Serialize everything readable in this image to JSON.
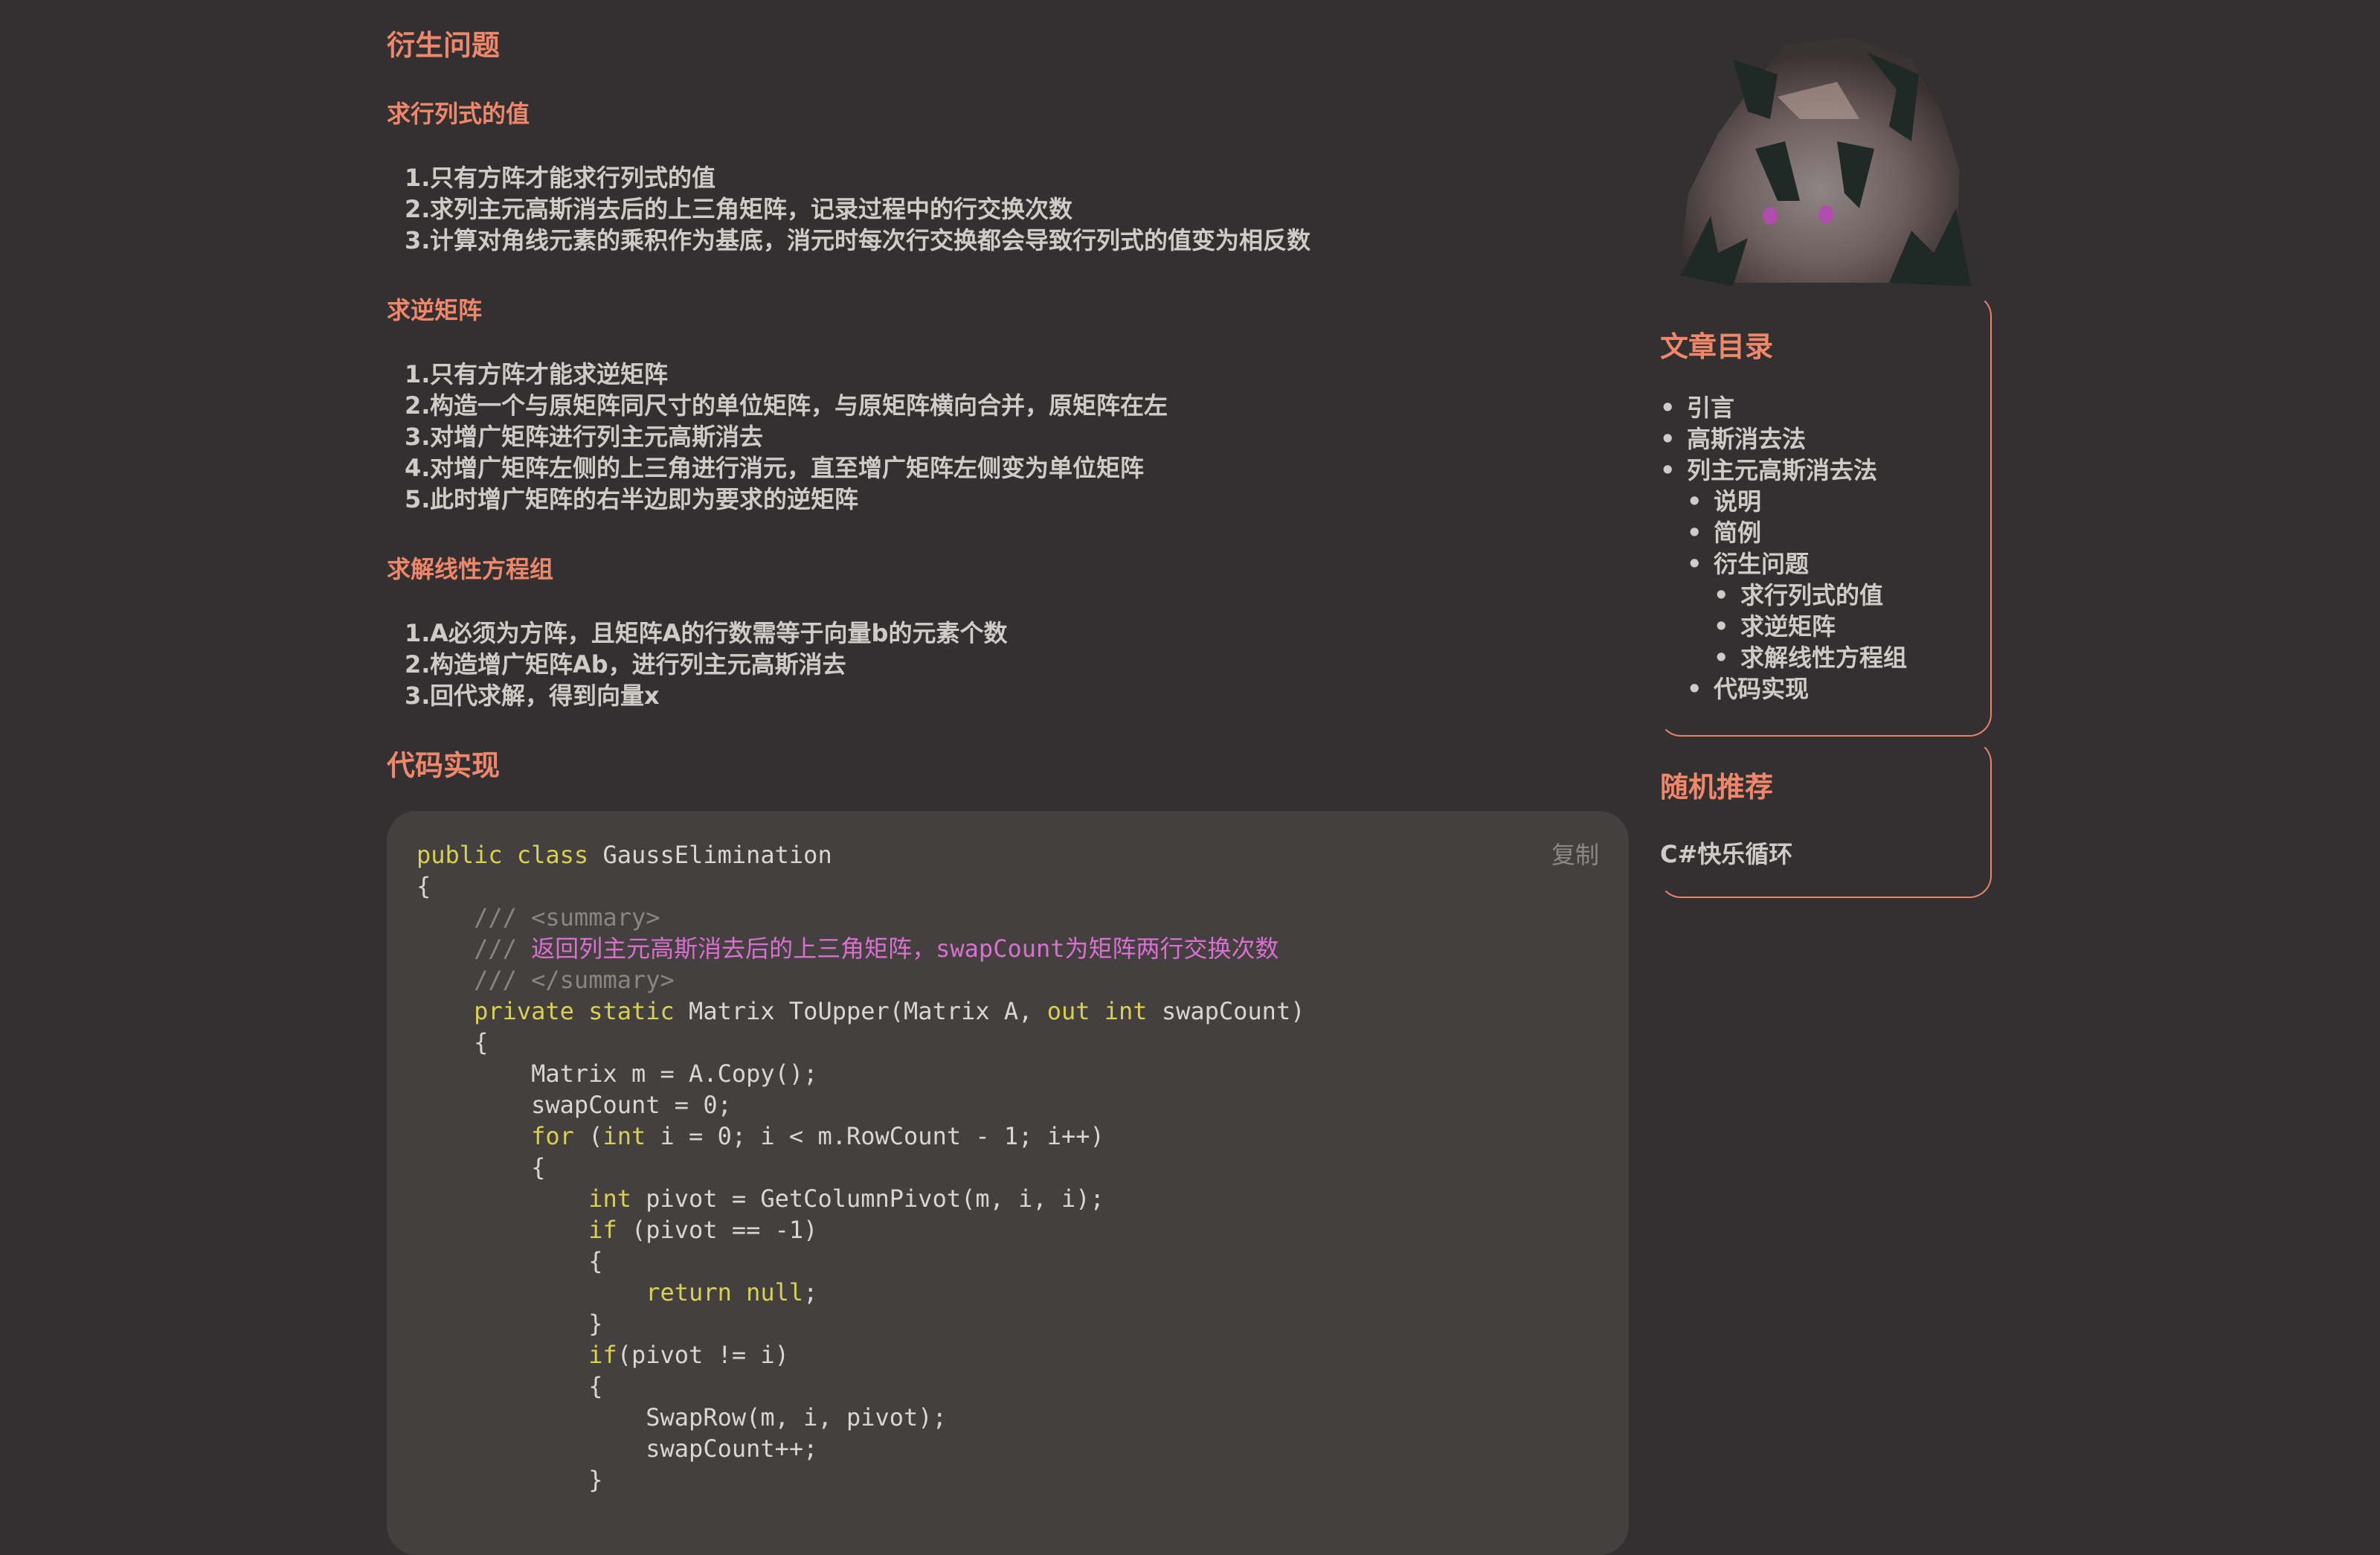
{
  "article": {
    "section_derived": "衍生问题",
    "determinant": {
      "title": "求行列式的值",
      "steps": [
        "只有方阵才能求行列式的值",
        "求列主元高斯消去后的上三角矩阵，记录过程中的行交换次数",
        "计算对角线元素的乘积作为基底，消元时每次行交换都会导致行列式的值变为相反数"
      ]
    },
    "inverse": {
      "title": "求逆矩阵",
      "steps": [
        "只有方阵才能求逆矩阵",
        "构造一个与原矩阵同尺寸的单位矩阵，与原矩阵横向合并，原矩阵在左",
        "对增广矩阵进行列主元高斯消去",
        "对增广矩阵左侧的上三角进行消元，直至增广矩阵左侧变为单位矩阵",
        "此时增广矩阵的右半边即为要求的逆矩阵"
      ]
    },
    "linear": {
      "title": "求解线性方程组",
      "steps": [
        "A必须为方阵，且矩阵A的行数需等于向量b的元素个数",
        "构造增广矩阵Ab，进行列主元高斯消去",
        "回代求解，得到向量x"
      ]
    },
    "section_code": "代码实现",
    "copy_label": "复制",
    "code_lines": [
      [
        {
          "t": "public class ",
          "c": "kw"
        },
        {
          "t": "GaussElimination",
          "c": ""
        }
      ],
      [
        {
          "t": "{",
          "c": ""
        }
      ],
      [
        {
          "t": "    /// <summary>",
          "c": "cm"
        }
      ],
      [
        {
          "t": "    /// ",
          "c": "cm"
        },
        {
          "t": "返回列主元高斯消去后的上三角矩阵，swapCount为矩阵两行交换次数",
          "c": "cmz"
        }
      ],
      [
        {
          "t": "    /// </summary>",
          "c": "cm"
        }
      ],
      [
        {
          "t": "    private static ",
          "c": "kw"
        },
        {
          "t": "Matrix ToUpper(Matrix A, ",
          "c": ""
        },
        {
          "t": "out int ",
          "c": "kw"
        },
        {
          "t": "swapCount)",
          "c": ""
        }
      ],
      [
        {
          "t": "    {",
          "c": ""
        }
      ],
      [
        {
          "t": "        Matrix m = A.Copy();",
          "c": ""
        }
      ],
      [
        {
          "t": "        swapCount = 0;",
          "c": ""
        }
      ],
      [
        {
          "t": "        for ",
          "c": "kw"
        },
        {
          "t": "(",
          "c": ""
        },
        {
          "t": "int ",
          "c": "kw"
        },
        {
          "t": "i = 0; i < m.RowCount - 1; i++)",
          "c": ""
        }
      ],
      [
        {
          "t": "        {",
          "c": ""
        }
      ],
      [
        {
          "t": "            int ",
          "c": "kw"
        },
        {
          "t": "pivot = GetColumnPivot(m, i, i);",
          "c": ""
        }
      ],
      [
        {
          "t": "            if ",
          "c": "kw"
        },
        {
          "t": "(pivot == -1)",
          "c": ""
        }
      ],
      [
        {
          "t": "            {",
          "c": ""
        }
      ],
      [
        {
          "t": "                return null",
          "c": "kw"
        },
        {
          "t": ";",
          "c": ""
        }
      ],
      [
        {
          "t": "            }",
          "c": ""
        }
      ],
      [
        {
          "t": "            if",
          "c": "kw"
        },
        {
          "t": "(pivot != i)",
          "c": ""
        }
      ],
      [
        {
          "t": "            {",
          "c": ""
        }
      ],
      [
        {
          "t": "                SwapRow(m, i, pivot);",
          "c": ""
        }
      ],
      [
        {
          "t": "                swapCount++;",
          "c": ""
        }
      ],
      [
        {
          "t": "            }",
          "c": ""
        }
      ]
    ]
  },
  "sidebar": {
    "toc_title": "文章目录",
    "toc": [
      {
        "label": "引言",
        "level": 0
      },
      {
        "label": "高斯消去法",
        "level": 0
      },
      {
        "label": "列主元高斯消去法",
        "level": 0
      },
      {
        "label": "说明",
        "level": 1
      },
      {
        "label": "简例",
        "level": 1
      },
      {
        "label": "衍生问题",
        "level": 1
      },
      {
        "label": "求行列式的值",
        "level": 2
      },
      {
        "label": "求逆矩阵",
        "level": 2
      },
      {
        "label": "求解线性方程组",
        "level": 2
      },
      {
        "label": "代码实现",
        "level": 1
      }
    ],
    "random_title": "随机推荐",
    "random_items": [
      "C#快乐循环"
    ]
  }
}
